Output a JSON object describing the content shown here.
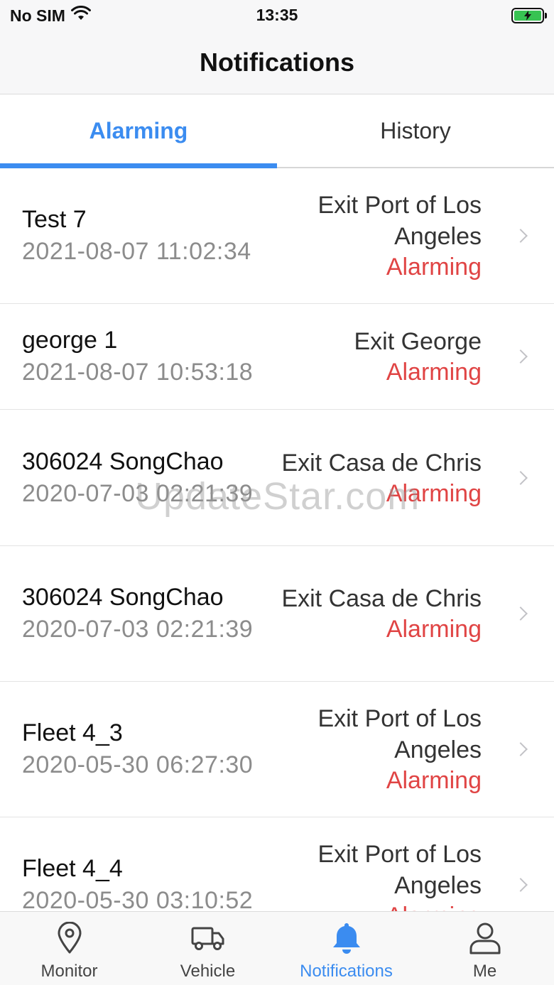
{
  "status_bar": {
    "carrier": "No SIM",
    "time": "13:35"
  },
  "header": {
    "title": "Notifications"
  },
  "tabs": [
    {
      "label": "Alarming",
      "active": true
    },
    {
      "label": "History",
      "active": false
    }
  ],
  "notifications": [
    {
      "name": "Test 7",
      "time": "2021-08-07 11:02:34",
      "fence": "Exit Port of Los Angeles",
      "status": "Alarming"
    },
    {
      "name": "george 1",
      "time": "2021-08-07 10:53:18",
      "fence": "Exit George",
      "status": "Alarming"
    },
    {
      "name": "306024 SongChao",
      "time": "2020-07-03 02:21:39",
      "fence": "Exit Casa de Chris",
      "status": "Alarming"
    },
    {
      "name": "306024 SongChao",
      "time": "2020-07-03 02:21:39",
      "fence": "Exit Casa de Chris",
      "status": "Alarming"
    },
    {
      "name": "Fleet 4_3",
      "time": "2020-05-30 06:27:30",
      "fence": "Exit Port of Los Angeles",
      "status": "Alarming"
    },
    {
      "name": "Fleet 4_4",
      "time": "2020-05-30 03:10:52",
      "fence": "Exit Port of Los Angeles",
      "status": "Alarming"
    }
  ],
  "watermark": "UpdateStar.com",
  "tabbar": [
    {
      "label": "Monitor",
      "icon": "map-pin-icon",
      "active": false
    },
    {
      "label": "Vehicle",
      "icon": "truck-icon",
      "active": false
    },
    {
      "label": "Notifications",
      "icon": "bell-icon",
      "active": true
    },
    {
      "label": "Me",
      "icon": "user-icon",
      "active": false
    }
  ],
  "colors": {
    "accent": "#3b8cf0",
    "alarm": "#e04444",
    "battery": "#37c352"
  }
}
